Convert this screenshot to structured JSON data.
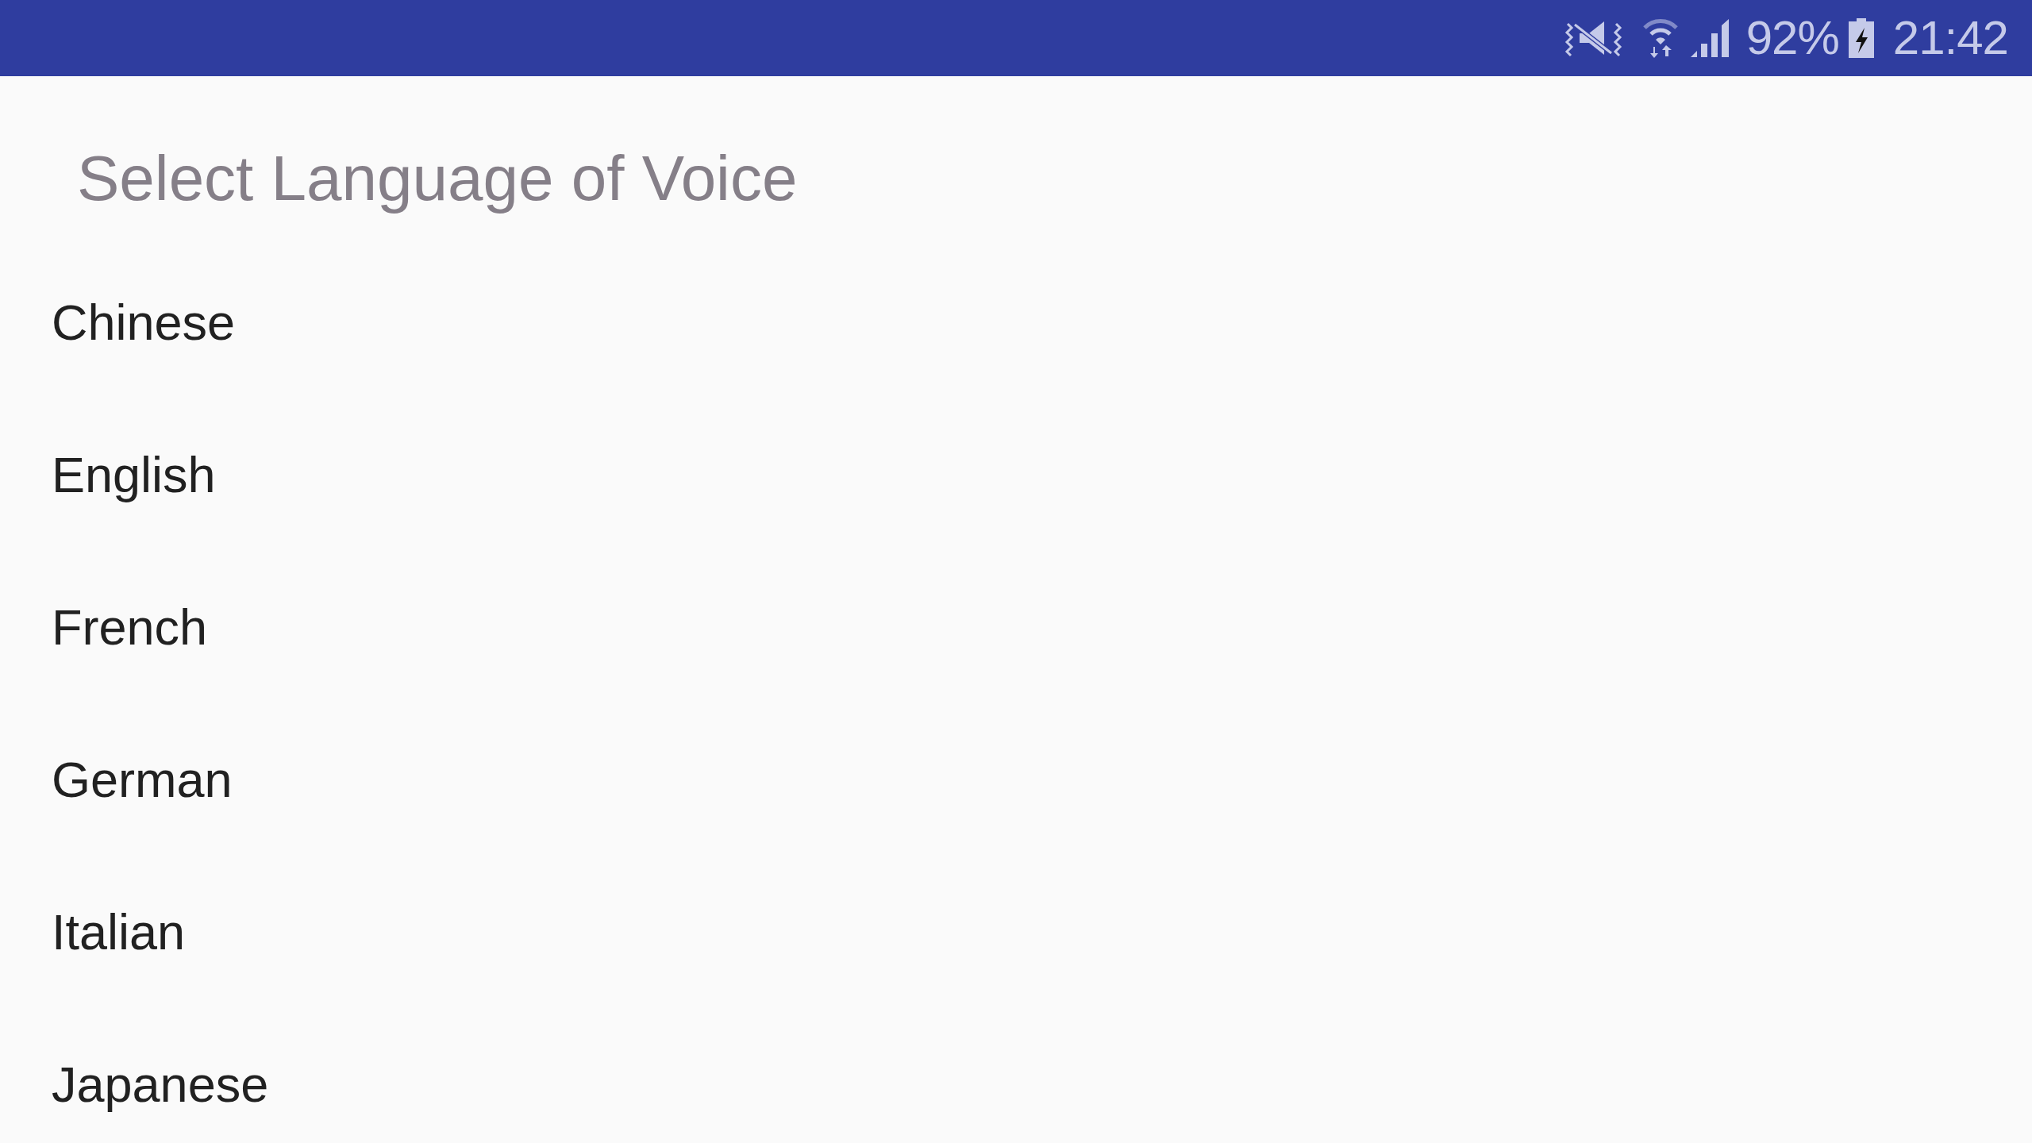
{
  "status_bar": {
    "battery": "92%",
    "time": "21:42"
  },
  "title": "Select Language of Voice",
  "languages": [
    "Chinese",
    "English",
    "French",
    "German",
    "Italian",
    "Japanese"
  ]
}
